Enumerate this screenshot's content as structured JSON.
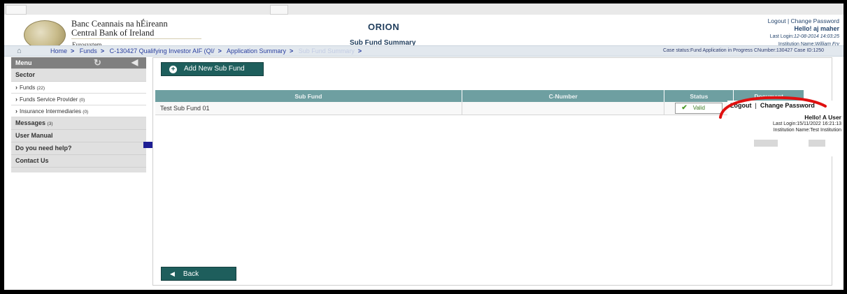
{
  "header": {
    "bank_name_irish": "Banc Ceannais na hÉireann",
    "bank_name_english": "Central Bank of Ireland",
    "eurosystem": "Eurosystem",
    "app_title": "ORION",
    "page_title": "Sub Fund Summary",
    "logout": "Logout",
    "change_password": "Change Password",
    "hello": "Hello! aj maher",
    "last_login_label": "Last Login:",
    "last_login_value": "12-08-2014 14:03:25",
    "institution_label": "Institution Name:",
    "institution_value": "William Fry"
  },
  "breadcrumb": {
    "items": [
      "Home",
      "Funds",
      "C-130427 Qualifying Investor AIF (QI/",
      "Application Summary",
      "Sub Fund Summary"
    ],
    "case_status": "Case status:Fund Application in Progress   CNumber:130427   Case ID:1250"
  },
  "sidebar": {
    "menu": "Menu",
    "sector": "Sector",
    "funds": "Funds",
    "funds_count": "(22)",
    "fsp": "Funds Service Provider",
    "fsp_count": "(0)",
    "ii": "Insurance Intermediaries",
    "ii_count": "(0)",
    "messages": "Messages",
    "messages_count": "(3)",
    "user_manual": "User Manual",
    "help": "Do you need help?",
    "contact": "Contact Us"
  },
  "main": {
    "add_button": "Add New Sub Fund",
    "back_button": "Back",
    "columns": [
      "Sub Fund",
      "C-Number",
      "Status",
      "Document"
    ],
    "rows": [
      {
        "sub_fund": "Test Sub Fund 01",
        "c_number": "",
        "status": "Valid",
        "document": ""
      }
    ]
  },
  "overlay": {
    "logout": "Logout",
    "change_password": "Change Password",
    "hello": "Hello! A User",
    "last_login": "Last Login:15/11/2022 16:21:13",
    "institution": "Institution Name:Test Institution"
  },
  "colors": {
    "button": "#1e5e5c",
    "table_header": "#6e9fa1",
    "annotation": "#e01010",
    "marker": "#1d1e94"
  }
}
